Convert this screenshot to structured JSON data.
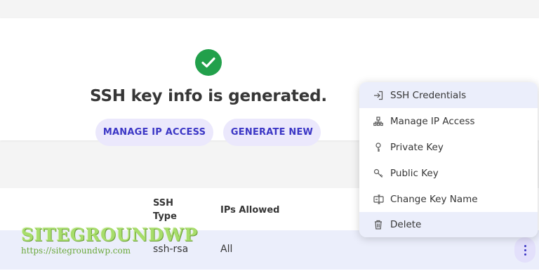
{
  "header": {
    "title": "SSH key info is generated.",
    "status_icon": "check-circle-icon",
    "accent_color": "#3b36c5",
    "success_color": "#22a04b"
  },
  "actions": {
    "manage_ip_access": "MANAGE IP ACCESS",
    "generate_new": "GENERATE NEW"
  },
  "table": {
    "columns": [
      "SSH Type",
      "IPs Allowed"
    ],
    "rows": [
      {
        "ssh_type": "ssh-rsa",
        "ips_allowed": "All"
      }
    ]
  },
  "context_menu": {
    "items": [
      {
        "label": "SSH Credentials",
        "icon": "sign-in-icon",
        "highlighted": true
      },
      {
        "label": "Manage IP Access",
        "icon": "network-icon",
        "highlighted": false
      },
      {
        "label": "Private Key",
        "icon": "key-icon",
        "highlighted": false
      },
      {
        "label": "Public Key",
        "icon": "key-alt-icon",
        "highlighted": false
      },
      {
        "label": "Change Key Name",
        "icon": "rename-icon",
        "highlighted": false
      },
      {
        "label": "Delete",
        "icon": "trash-icon",
        "highlighted": true
      }
    ]
  },
  "watermark": {
    "logo": "SITEGROUNDWP",
    "url": "https://sitegroundwp.com"
  }
}
